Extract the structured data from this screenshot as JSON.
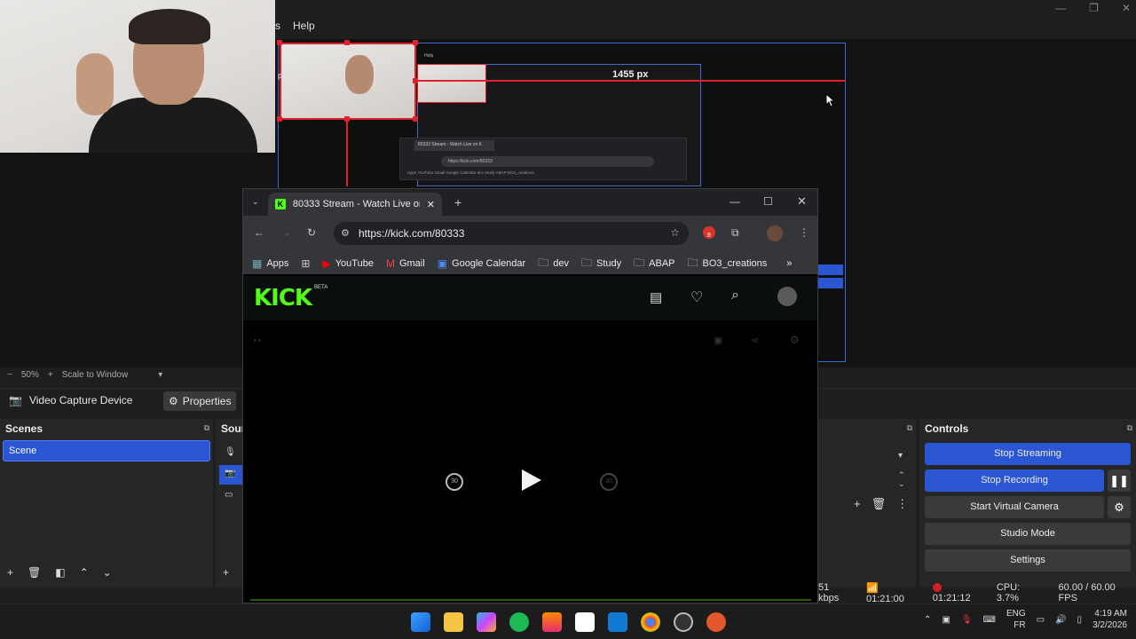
{
  "obs": {
    "menu": {
      "partial": "s",
      "help": "Help"
    },
    "canvas_overlay": {
      "width_label": "1455 px",
      "side_label": "px"
    },
    "preview_toolbar": {
      "zoom": "50%",
      "scale": "Scale to Window"
    },
    "source_bar": {
      "source_name": "Video Capture Device",
      "properties": "Properties"
    },
    "scenes": {
      "title": "Scenes",
      "items": [
        "Scene"
      ]
    },
    "sources": {
      "title_partial": "Sour"
    },
    "controls": {
      "title": "Controls",
      "stop_streaming": "Stop Streaming",
      "stop_recording": "Stop Recording",
      "start_virtual_camera": "Start Virtual Camera",
      "studio_mode": "Studio Mode",
      "settings": "Settings"
    },
    "status": {
      "bitrate": "51 kbps",
      "stream_time": "01:21:00",
      "rec_time": "01:21:12",
      "cpu": "CPU: 3.7%",
      "fps": "60.00 / 60.00 FPS"
    }
  },
  "chrome": {
    "tab_title": "80333 Stream - Watch Live on K",
    "url": "https://kick.com/80333",
    "extension_badge": "8",
    "bookmarks": [
      "Apps",
      "YouTube",
      "Gmail",
      "Google Calendar",
      "dev",
      "Study",
      "ABAP",
      "BO3_creations"
    ],
    "kick": {
      "logo": "KICK",
      "beta": "BETA"
    },
    "player": {
      "rewind": "30",
      "forward": "30"
    }
  },
  "inner_capture": {
    "tab": "80333 Stream - Watch Live on K",
    "url": "https://kick.com/80333",
    "bookmarks": "Apps  YouTube  Gmail  Google Calendar  dev  Study  ABAP  BO3_creations",
    "help": "Help"
  },
  "taskbar": {
    "lang": "ENG",
    "region": "FR",
    "time": "4:19 AM",
    "date": "3/2/2026"
  },
  "colors": {
    "obs_accent": "#2a56d3",
    "kick_green": "#53fc18",
    "selection_red": "#e0202a"
  }
}
